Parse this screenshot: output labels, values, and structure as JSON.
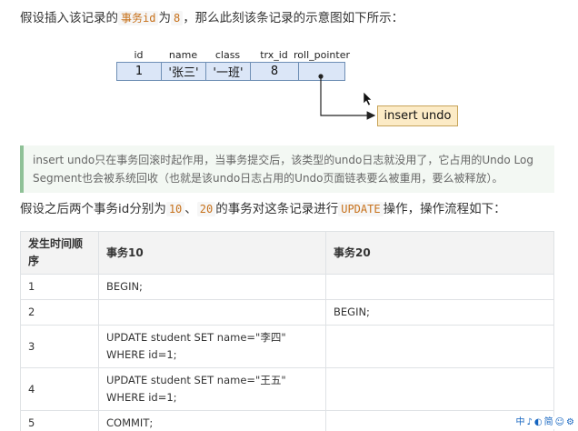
{
  "intro": {
    "part1": "假设插入该记录的",
    "code": "事务id",
    "part2": "为",
    "value": "8",
    "part3": "，那么此刻该条记录的示意图如下所示："
  },
  "diagram": {
    "columns": [
      "id",
      "name",
      "class",
      "trx_id",
      "roll_pointer"
    ],
    "values": [
      "1",
      "'张三'",
      "'一班'",
      "8",
      ""
    ],
    "undo_label": "insert undo"
  },
  "note": {
    "line1": "insert undo只在事务回滚时起作用，当事务提交后，该类型的undo日志就没用了，它占用的Undo Log",
    "line2": "Segment也会被系统回收（也就是该undo日志占用的Undo页面链表要么被重用，要么被释放）。"
  },
  "para2": {
    "part1": "假设之后两个事务id分别为",
    "code1": "10",
    "sep": "、",
    "code2": "20",
    "part2": "的事务对这条记录进行",
    "code3": "UPDATE",
    "part3": "操作，操作流程如下："
  },
  "table": {
    "headers": [
      "发生时间顺序",
      "事务10",
      "事务20"
    ],
    "rows": [
      [
        "1",
        "BEGIN;",
        ""
      ],
      [
        "2",
        "",
        "BEGIN;"
      ],
      [
        "3",
        "UPDATE student SET name=\"李四\" WHERE id=1;",
        ""
      ],
      [
        "4",
        "UPDATE student SET name=\"王五\" WHERE id=1;",
        ""
      ],
      [
        "5",
        "COMMIT;",
        ""
      ]
    ]
  },
  "ime_bar": [
    "中",
    "♪",
    "◐",
    "简",
    "☺",
    "⚙"
  ]
}
